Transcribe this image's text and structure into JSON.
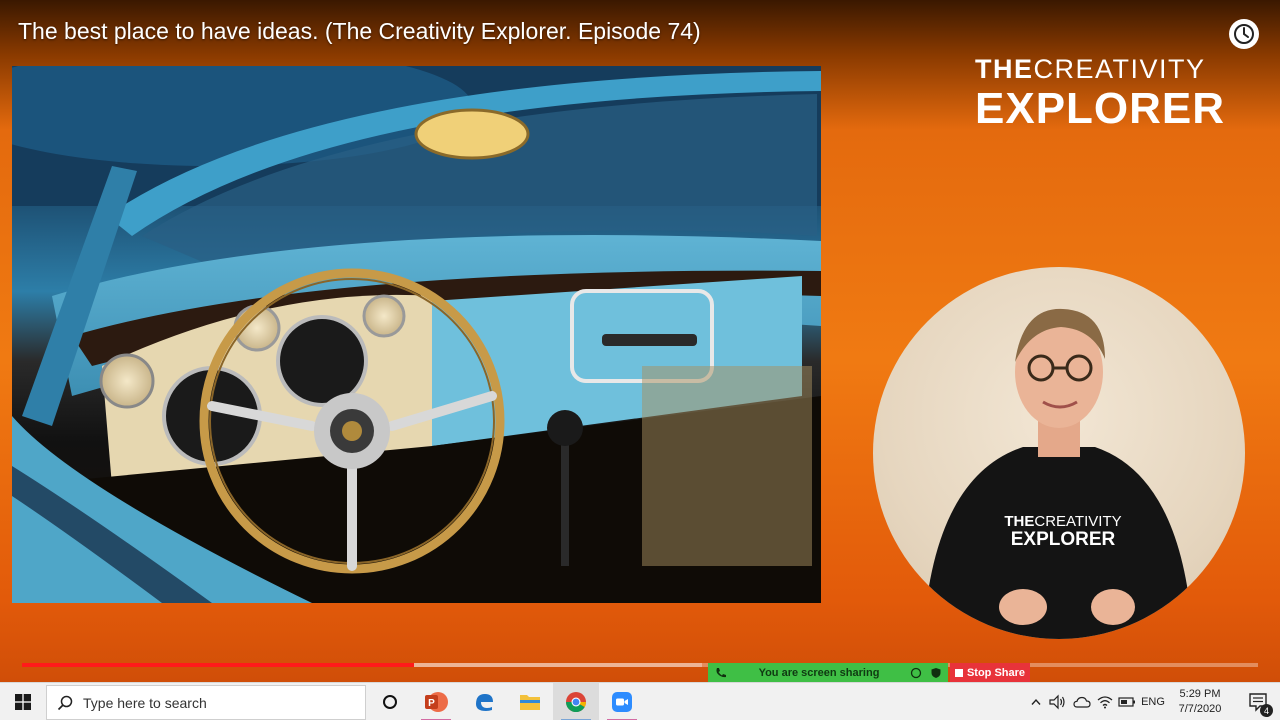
{
  "video": {
    "title": "The best place to have ideas. (The Creativity Explorer. Episode 74)",
    "progress_fraction": 0.317,
    "buffer_fraction": 0.55
  },
  "brand": {
    "logo_top_bold": "THE",
    "logo_top_rest": "CREATIVITY",
    "logo_bottom": "EXPLORER"
  },
  "presenter": {
    "shirt_top_bold": "THE",
    "shirt_top_rest": "CREATIVITY",
    "shirt_bottom": "EXPLORER"
  },
  "zoom": {
    "sharing_label": "You are screen sharing",
    "stop_label": "Stop Share"
  },
  "taskbar": {
    "search_placeholder": "Type here to search",
    "language": "ENG",
    "time": "5:29 PM",
    "date": "7/7/2020",
    "notification_count": "4"
  },
  "colors": {
    "accent_orange": "#f07a12",
    "progress_red": "#ff1a1a",
    "share_green": "#3fbf45",
    "stop_red": "#e8333a"
  },
  "icons": [
    "clock-icon",
    "windows-start-icon",
    "search-icon",
    "cortana-icon",
    "powerpoint-icon",
    "edge-icon",
    "file-explorer-icon",
    "chrome-icon",
    "zoom-icon",
    "chevron-up-icon",
    "volume-icon",
    "onedrive-icon",
    "wifi-icon",
    "battery-icon",
    "notification-icon"
  ]
}
